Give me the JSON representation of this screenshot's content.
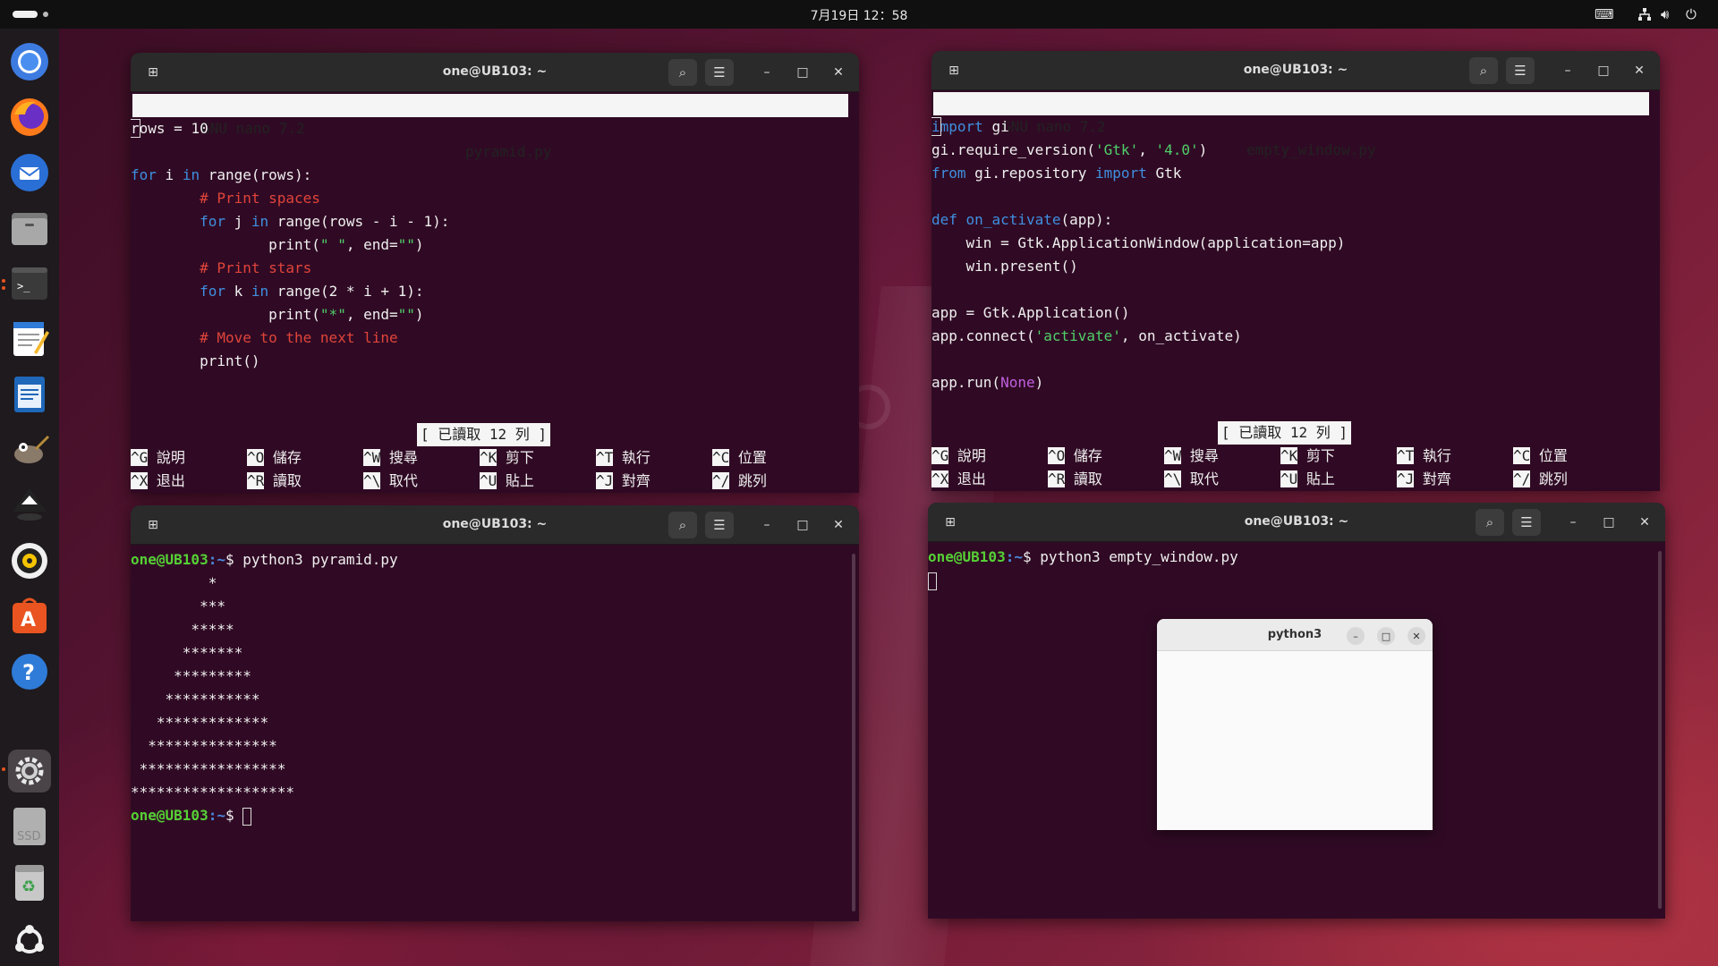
{
  "topbar": {
    "clock": "7月19日 12：58",
    "icons": [
      "keyboard-icon",
      "network-icon",
      "volume-icon",
      "power-icon"
    ]
  },
  "dock": {
    "items": [
      "chromium-icon",
      "firefox-icon",
      "thunderbird-icon",
      "files-icon",
      "terminal-icon",
      "text-editor-icon",
      "writer-icon",
      "gimp-icon",
      "inkscape-icon",
      "rhythmbox-icon",
      "app-center-icon",
      "help-icon",
      "settings-icon",
      "ssd-drive-icon",
      "trash-icon",
      "show-apps-icon"
    ],
    "ssd_label": "SSD"
  },
  "windows": {
    "nano_pyramid": {
      "title": "one@UB103: ~",
      "header_left": "  GNU nano 7.2",
      "header_file": "pyramid.py",
      "code": [
        "rows = 10",
        "",
        "for i in range(rows):",
        "        # Print spaces",
        "        for j in range(rows - i - 1):",
        "                print(\" \", end=\"\")",
        "        # Print stars",
        "        for k in range(2 * i + 1):",
        "                print(\"*\", end=\"\")",
        "        # Move to the next line",
        "        print()"
      ],
      "status": "[ 已讀取 12 列 ]"
    },
    "nano_empty": {
      "title": "one@UB103: ~",
      "header_left": "  GNU nano 7.2",
      "header_file": "empty_window.py",
      "code": [
        "import gi",
        "gi.require_version('Gtk', '4.0')",
        "from gi.repository import Gtk",
        "",
        "def on_activate(app):",
        "    win = Gtk.ApplicationWindow(application=app)",
        "    win.present()",
        "",
        "app = Gtk.Application()",
        "app.connect('activate', on_activate)",
        "",
        "app.run(None)"
      ],
      "status": "[ 已讀取 12 列 ]"
    },
    "nano_shortcuts": [
      [
        {
          "key": "^G",
          "label": "說明"
        },
        {
          "key": "^O",
          "label": "儲存"
        },
        {
          "key": "^W",
          "label": "搜尋"
        },
        {
          "key": "^K",
          "label": "剪下"
        },
        {
          "key": "^T",
          "label": "執行"
        },
        {
          "key": "^C",
          "label": "位置"
        }
      ],
      [
        {
          "key": "^X",
          "label": "退出"
        },
        {
          "key": "^R",
          "label": "讀取"
        },
        {
          "key": "^\\",
          "label": "取代"
        },
        {
          "key": "^U",
          "label": "貼上"
        },
        {
          "key": "^J",
          "label": "對齊"
        },
        {
          "key": "^/",
          "label": "跳列"
        }
      ]
    ],
    "term_pyramid": {
      "title": "one@UB103: ~",
      "prompt_user": "one@UB103",
      "prompt_path": ":~",
      "prompt_symbol": "$ ",
      "command": "python3 pyramid.py",
      "output": [
        "         *",
        "        ***",
        "       *****",
        "      *******",
        "     *********",
        "    ***********",
        "   *************",
        "  ***************",
        " *****************",
        "*******************"
      ]
    },
    "term_empty": {
      "title": "one@UB103: ~",
      "prompt_user": "one@UB103",
      "prompt_path": ":~",
      "prompt_symbol": "$ ",
      "command": "python3 empty_window.py"
    },
    "python_window": {
      "title": "python3"
    }
  }
}
